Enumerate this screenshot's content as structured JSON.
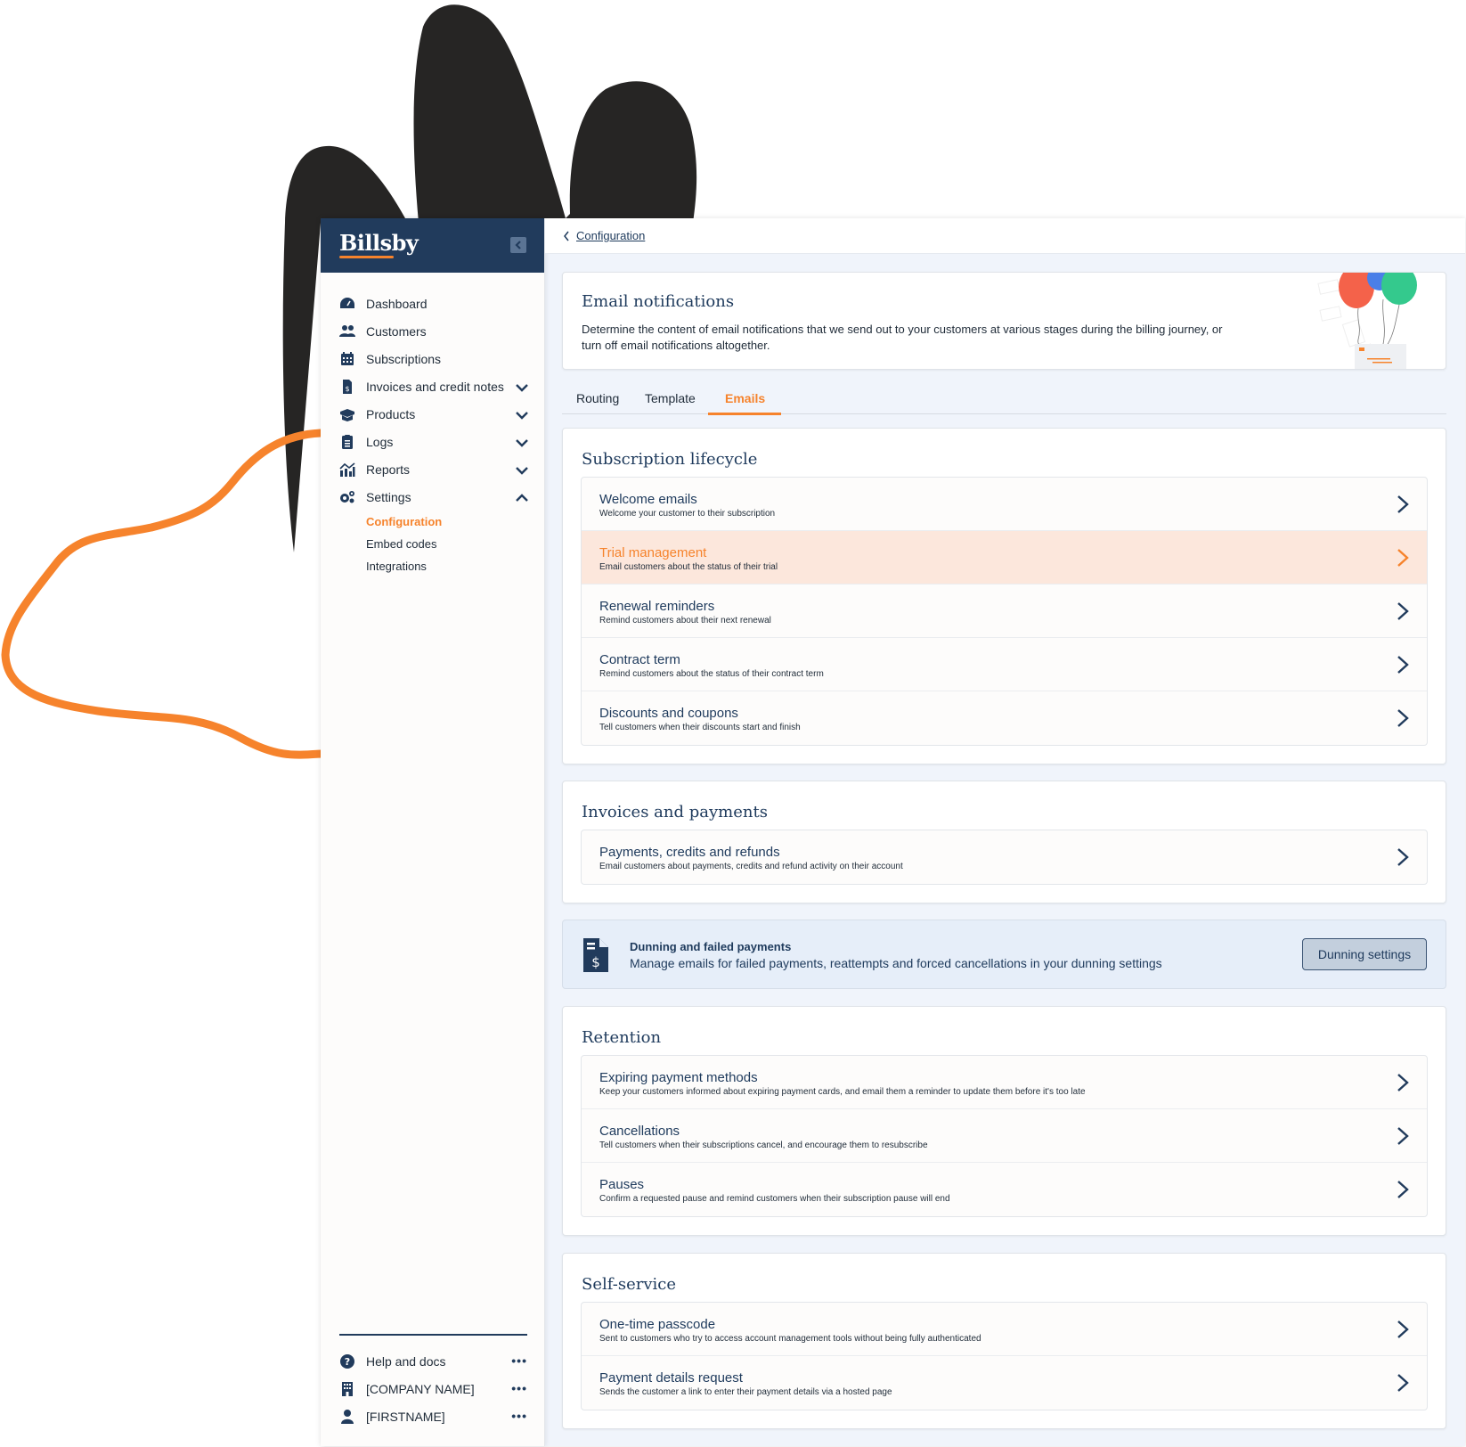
{
  "brand": {
    "name": "Billsby",
    "accent": "#f6832c",
    "navy": "#213b5c",
    "highlight_bg": "#fce7dc"
  },
  "sidebar": {
    "items": [
      {
        "label": "Dashboard",
        "icon": "dashboard-icon",
        "has_chevron": false
      },
      {
        "label": "Customers",
        "icon": "users-icon",
        "has_chevron": false
      },
      {
        "label": "Subscriptions",
        "icon": "calendar-icon",
        "has_chevron": false
      },
      {
        "label": "Invoices and credit notes",
        "icon": "invoice-icon",
        "has_chevron": true,
        "expanded": false
      },
      {
        "label": "Products",
        "icon": "box-icon",
        "has_chevron": true,
        "expanded": false
      },
      {
        "label": "Logs",
        "icon": "clipboard-icon",
        "has_chevron": true,
        "expanded": false
      },
      {
        "label": "Reports",
        "icon": "chart-icon",
        "has_chevron": true,
        "expanded": false
      },
      {
        "label": "Settings",
        "icon": "gears-icon",
        "has_chevron": true,
        "expanded": true
      }
    ],
    "settings_sub": [
      {
        "label": "Configuration",
        "active": true
      },
      {
        "label": "Embed codes",
        "active": false
      },
      {
        "label": "Integrations",
        "active": false
      }
    ],
    "footer": [
      {
        "label": "Help and docs",
        "icon": "help-icon"
      },
      {
        "label": "[COMPANY NAME]",
        "icon": "building-icon"
      },
      {
        "label": "[FIRSTNAME]",
        "icon": "user-icon"
      }
    ],
    "more_glyph": "•••"
  },
  "breadcrumb": {
    "label": "Configuration"
  },
  "hero": {
    "title": "Email notifications",
    "description": "Determine the content of email notifications that we send out to your customers at various stages during the billing journey, or turn off email notifications altogether."
  },
  "tabs": [
    {
      "label": "Routing",
      "active": false
    },
    {
      "label": "Template",
      "active": false
    },
    {
      "label": "Emails",
      "active": true
    }
  ],
  "sections": {
    "lifecycle": {
      "title": "Subscription lifecycle",
      "rows": [
        {
          "title": "Welcome emails",
          "desc": "Welcome your customer to their subscription"
        },
        {
          "title": "Trial management",
          "desc": "Email customers about the status of their trial",
          "highlighted": true
        },
        {
          "title": "Renewal reminders",
          "desc": "Remind customers about their next renewal"
        },
        {
          "title": "Contract term",
          "desc": "Remind customers about the status of their contract term"
        },
        {
          "title": "Discounts and coupons",
          "desc": "Tell customers when their discounts start and finish"
        }
      ]
    },
    "invoices": {
      "title": "Invoices and payments",
      "rows": [
        {
          "title": "Payments, credits and refunds",
          "desc": "Email customers about payments, credits and refund activity on their account"
        }
      ]
    },
    "retention": {
      "title": "Retention",
      "rows": [
        {
          "title": "Expiring payment methods",
          "desc": "Keep your customers informed about expiring payment cards, and email them a reminder to update them before it's too late"
        },
        {
          "title": "Cancellations",
          "desc": "Tell customers when their subscriptions cancel, and encourage them to resubscribe"
        },
        {
          "title": "Pauses",
          "desc": "Confirm a requested pause and remind customers when their subscription pause will end"
        }
      ]
    },
    "self_service": {
      "title": "Self-service",
      "rows": [
        {
          "title": "One-time passcode",
          "desc": "Sent to customers who try to access account management tools without being fully authenticated"
        },
        {
          "title": "Payment details request",
          "desc": "Sends the customer a link to enter their payment details via a hosted page"
        }
      ]
    }
  },
  "dunning": {
    "title": "Dunning and failed payments",
    "description": "Manage emails for failed payments, reattempts and forced cancellations in your dunning settings",
    "button": "Dunning settings"
  }
}
